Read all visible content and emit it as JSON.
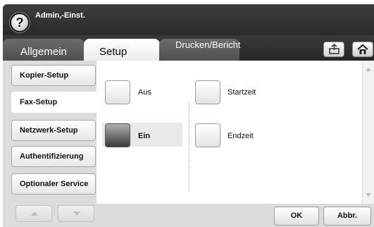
{
  "header": {
    "help_icon_glyph": "?",
    "user_label": "Admin,-Einst."
  },
  "tabs": [
    {
      "label": "Allgemein",
      "selected": false
    },
    {
      "label": "Setup",
      "selected": true
    },
    {
      "label": "Drucken/Bericht",
      "selected": false
    }
  ],
  "toolbar": {
    "export_icon": "export-icon",
    "home_icon": "home-icon"
  },
  "sidebar": {
    "items": [
      {
        "label": "Kopier-Setup",
        "selected": false
      },
      {
        "label": "Fax-Setup",
        "selected": true
      },
      {
        "label": "Netzwerk-Setup",
        "selected": false
      },
      {
        "label": "Authentifizierung",
        "selected": false
      },
      {
        "label": "Optionaler Service",
        "selected": false
      }
    ]
  },
  "options": {
    "aus": {
      "label": "Aus",
      "checked": false
    },
    "ein": {
      "label": "Ein",
      "checked": true
    },
    "startzeit": {
      "label": "Startzeit"
    },
    "endzeit": {
      "label": "Endzeit"
    }
  },
  "footer": {
    "ok_label": "OK",
    "cancel_label": "Abbr."
  },
  "colors": {
    "bar_dark": "#2a2a2a",
    "panel_gray": "#dcdcdc",
    "selected_check": "#3a3a3a"
  }
}
